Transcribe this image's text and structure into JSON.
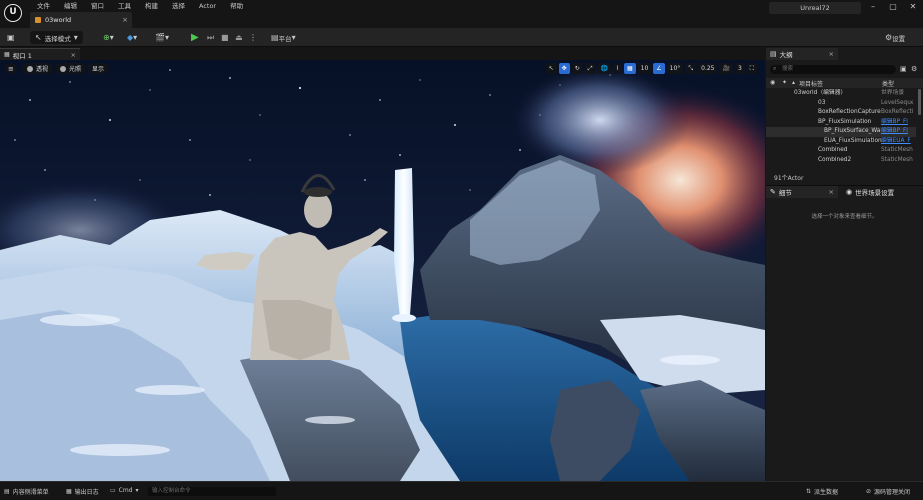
{
  "menu": [
    "文件",
    "编辑",
    "窗口",
    "工具",
    "构建",
    "选择",
    "Actor",
    "帮助"
  ],
  "tab": {
    "title": "03world"
  },
  "project": "Unreal72",
  "toolbar": {
    "mode": "选择模式",
    "platform": "平台",
    "settings": "设置"
  },
  "viewport": {
    "tab": "视口 1",
    "pills": [
      "透视",
      "光照",
      "显示"
    ],
    "grid_snap": "10",
    "angle_snap": "10°",
    "scale_snap": "0.25",
    "camera_speed": "3"
  },
  "outliner": {
    "tab": "大纲",
    "search_placeholder": "搜索",
    "col_label": "项目标签",
    "col_type": "类型",
    "rows": [
      {
        "name": "03world（编辑器）",
        "type": "世界场景"
      },
      {
        "name": "03",
        "type": "LevelSeque"
      },
      {
        "name": "BoxReflectionCapture",
        "type": "BoxReflecti"
      },
      {
        "name": "BP_FluxSimulation",
        "type": "编辑BP_Fl"
      },
      {
        "name": "BP_FluxSurface_Wa",
        "type": "编辑BP_Fl"
      },
      {
        "name": "EUA_FluxSimulation",
        "type": "编辑EUA_F"
      },
      {
        "name": "Combined",
        "type": "StaticMesh"
      },
      {
        "name": "Combined2",
        "type": "StaticMesh"
      }
    ],
    "count": "91个Actor"
  },
  "details": {
    "tab": "细节",
    "tab2": "世界场景设置",
    "empty_msg": "选择一个对象来查看细节。"
  },
  "statusbar": {
    "content_drawer": "内容侧滑菜单",
    "output_log": "输出日志",
    "cmd": "Cmd",
    "cmd_placeholder": "输入控制台命令",
    "derived_data": "派生数据",
    "source_control": "源码管理关闭"
  },
  "colors": {
    "accent": "#2a6bd1",
    "play": "#4cc84c",
    "link": "#3d8bff"
  }
}
